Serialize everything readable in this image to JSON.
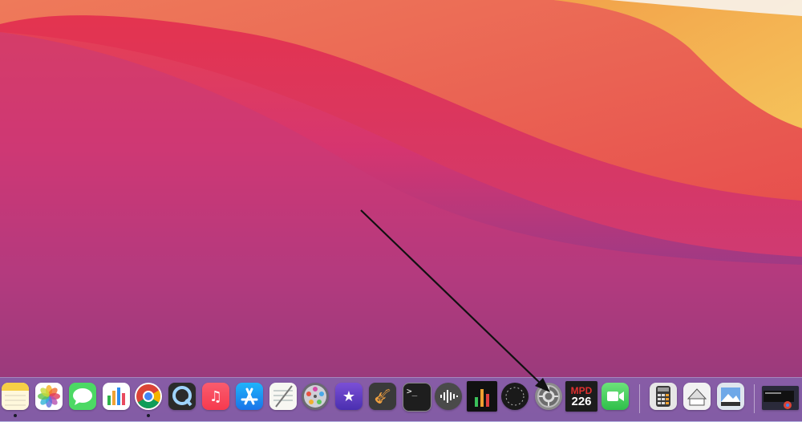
{
  "desktop": {
    "wallpaper": "macOS Big Sur"
  },
  "dock": {
    "items": [
      {
        "name": "notes",
        "icon": "notes-icon",
        "running": true
      },
      {
        "name": "photos",
        "icon": "photos-icon",
        "running": false
      },
      {
        "name": "messages",
        "icon": "messages-icon",
        "running": false
      },
      {
        "name": "numbers",
        "icon": "numbers-icon",
        "running": false
      },
      {
        "name": "chrome",
        "icon": "chrome-icon",
        "running": true
      },
      {
        "name": "quicktime",
        "icon": "quicktime-icon",
        "running": false
      },
      {
        "name": "music",
        "icon": "music-icon",
        "running": false
      },
      {
        "name": "app-store",
        "icon": "app-store-icon",
        "running": false
      },
      {
        "name": "textedit",
        "icon": "textedit-icon",
        "running": false
      },
      {
        "name": "final-cut",
        "icon": "film-reel-icon",
        "running": false
      },
      {
        "name": "imovie",
        "icon": "imovie-icon",
        "running": false
      },
      {
        "name": "garageband",
        "icon": "guitar-icon",
        "running": false
      },
      {
        "name": "terminal",
        "icon": "terminal-icon",
        "running": false
      },
      {
        "name": "audio-wave",
        "icon": "waveform-icon",
        "running": false
      },
      {
        "name": "meter",
        "icon": "bar-meter-icon",
        "running": false
      },
      {
        "name": "spitfire-audio",
        "icon": "spitfire-icon",
        "running": false
      },
      {
        "name": "system-preferences",
        "icon": "gear-icon",
        "running": false
      },
      {
        "name": "mpd226",
        "icon": "mpd226-icon",
        "running": false,
        "label_top": "MPD",
        "label_bottom": "226"
      },
      {
        "name": "facetime",
        "icon": "facetime-icon",
        "running": false
      },
      {
        "name": "calculator",
        "icon": "calculator-icon",
        "running": false
      },
      {
        "name": "printer",
        "icon": "printer-icon",
        "running": false
      },
      {
        "name": "preview",
        "icon": "preview-icon",
        "running": false
      },
      {
        "name": "recent-window",
        "icon": "window-thumbnail-icon",
        "running": false
      }
    ]
  },
  "colors": {
    "arrow": "#111111",
    "dock_running_dot": "#1b1b2a"
  }
}
